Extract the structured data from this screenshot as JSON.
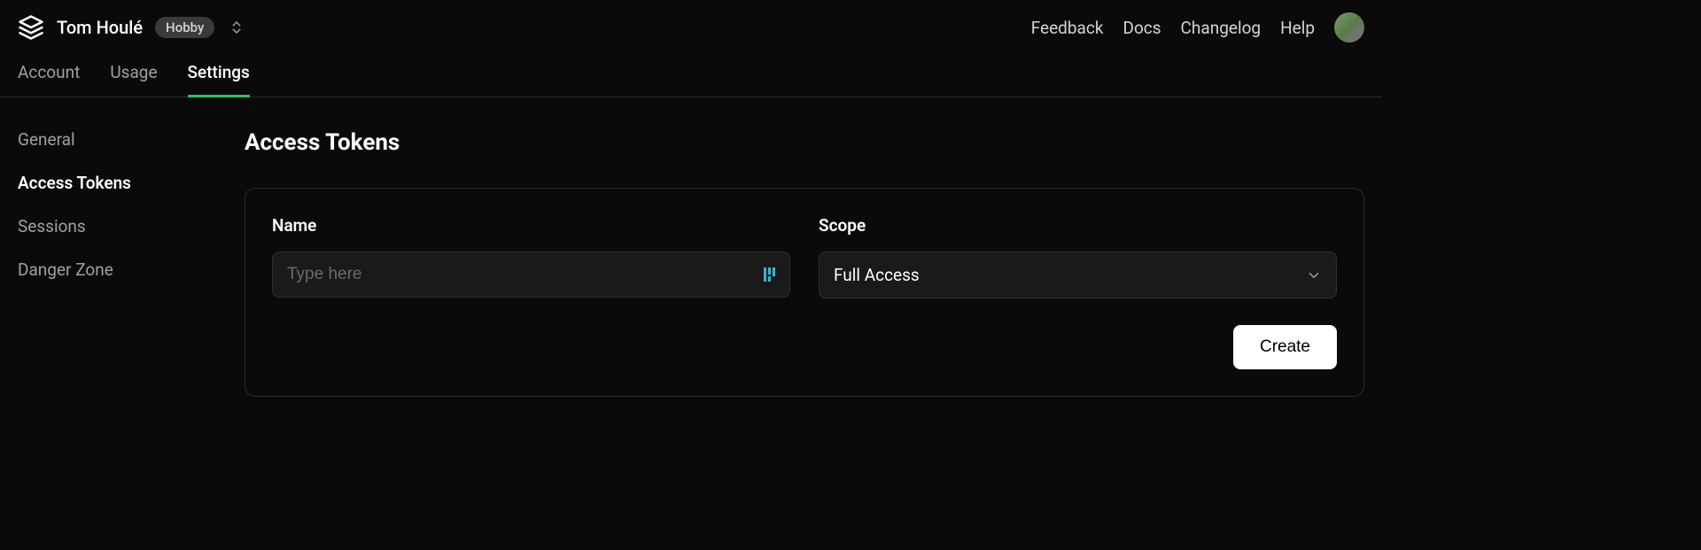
{
  "header": {
    "username": "Tom Houlé",
    "plan_badge": "Hobby",
    "links": {
      "feedback": "Feedback",
      "docs": "Docs",
      "changelog": "Changelog",
      "help": "Help"
    }
  },
  "tabs": {
    "account": "Account",
    "usage": "Usage",
    "settings": "Settings"
  },
  "sidebar": {
    "general": "General",
    "access_tokens": "Access Tokens",
    "sessions": "Sessions",
    "danger_zone": "Danger Zone"
  },
  "page": {
    "title": "Access Tokens"
  },
  "form": {
    "name_label": "Name",
    "name_placeholder": "Type here",
    "scope_label": "Scope",
    "scope_value": "Full Access",
    "create_label": "Create"
  }
}
